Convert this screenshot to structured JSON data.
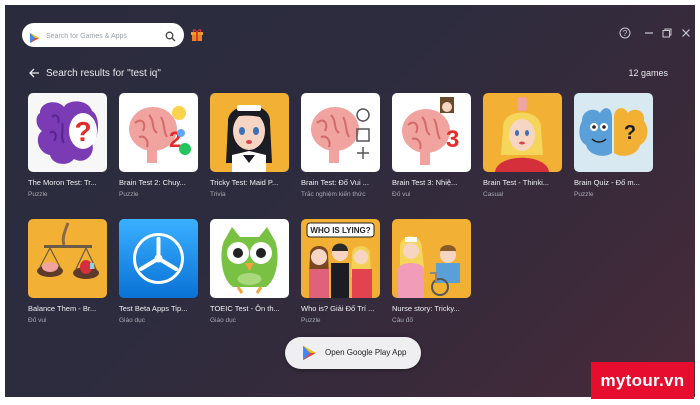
{
  "search": {
    "placeholder": "Search for Games & Apps"
  },
  "header": {
    "title": "Search results for \"test iq\"",
    "count": "12 games"
  },
  "games": [
    {
      "name": "The Moron Test: Tr...",
      "category": "Puzzle"
    },
    {
      "name": "Brain Test 2: Chuy...",
      "category": "Puzzle"
    },
    {
      "name": "Tricky Test: Maid P...",
      "category": "Trivia"
    },
    {
      "name": "Brain Test: Đố Vui ...",
      "category": "Trắc nghiệm kiến thức"
    },
    {
      "name": "Brain Test 3: Nhiệ...",
      "category": "Đố vui"
    },
    {
      "name": "Brain Test - Thinki...",
      "category": "Casual"
    },
    {
      "name": "Brain Quiz - Đố m...",
      "category": "Puzzle"
    },
    {
      "name": "Balance Them - Br...",
      "category": "Đố vui"
    },
    {
      "name": "Test Beta Apps Tip...",
      "category": "Giáo dục"
    },
    {
      "name": "TOEIC Test - Ôn th...",
      "category": "Giáo dục"
    },
    {
      "name": "Who is? Giải Đố Trí ...",
      "category": "Puzzle"
    },
    {
      "name": "Nurse story: Tricky...",
      "category": "Câu đố"
    }
  ],
  "thumb_text": {
    "who_is_lying": "WHO IS LYING?"
  },
  "open_button": {
    "label": "Open Google Play App"
  },
  "watermark": {
    "text": "mytour.vn"
  },
  "colors": {
    "background": "#2b2b3d",
    "brand_red": "#e60d2e",
    "card_text": "#f0f0f4",
    "category_text": "#a8a8b4"
  }
}
